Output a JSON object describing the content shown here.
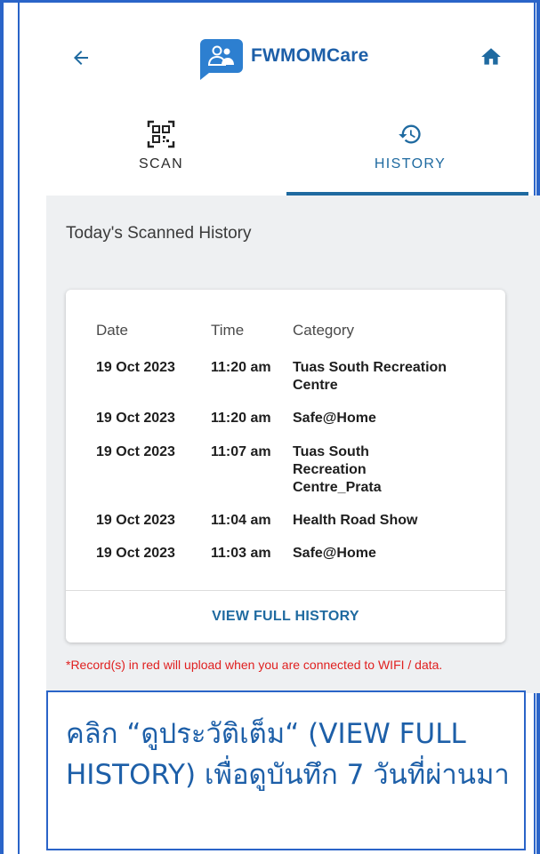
{
  "header": {
    "title": "FWMOMCare",
    "back_icon": "arrow-left-icon",
    "home_icon": "home-icon",
    "logo_icon": "fwmomcare-logo-icon"
  },
  "tabs": [
    {
      "label": "SCAN",
      "icon": "qr-code-icon",
      "active": false
    },
    {
      "label": "HISTORY",
      "icon": "history-icon",
      "active": true
    }
  ],
  "history": {
    "section_title": "Today's Scanned History",
    "columns": [
      "Date",
      "Time",
      "Category"
    ],
    "rows": [
      {
        "date": "19 Oct 2023",
        "time": "11:20 am",
        "category": "Tuas South Recreation Centre"
      },
      {
        "date": "19 Oct 2023",
        "time": "11:20 am",
        "category": "Safe@Home"
      },
      {
        "date": "19 Oct 2023",
        "time": "11:07 am",
        "category": "Tuas South Recreation Centre_Prata"
      },
      {
        "date": "19 Oct 2023",
        "time": "11:04 am",
        "category": "Health Road Show"
      },
      {
        "date": "19 Oct 2023",
        "time": "11:03 am",
        "category": "Safe@Home"
      }
    ],
    "view_full_label": "VIEW FULL HISTORY",
    "note": "*Record(s) in red will upload when you are connected to WIFI / data."
  },
  "callout": {
    "text": "คลิก “ดูประวัติเต็ม“ (VIEW FULL HISTORY) เพื่อดูบันทึก 7 วันที่ผ่านมา"
  },
  "colors": {
    "accent": "#1f6aa0",
    "brand_blue": "#2d7fd0",
    "frame_blue": "#2a64c8",
    "note_red": "#e02020",
    "content_bg": "#eef0f2"
  }
}
